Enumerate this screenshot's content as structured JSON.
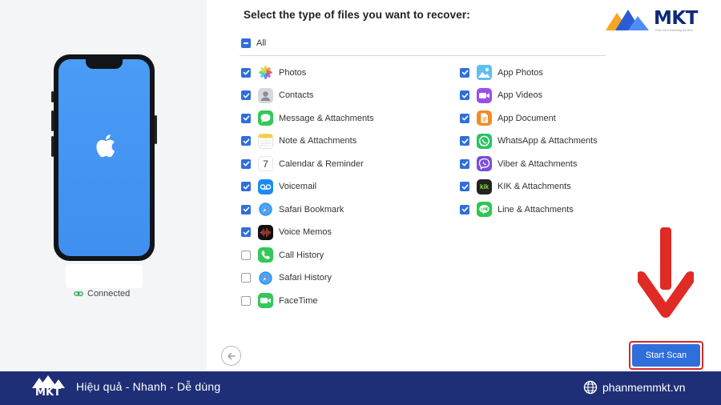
{
  "header": {
    "title": "Select the type of files you want to recover:"
  },
  "select_all": {
    "label": "All",
    "state": "partial"
  },
  "left_column": [
    {
      "label": "Photos",
      "checked": true,
      "icon": "photos-icon"
    },
    {
      "label": "Contacts",
      "checked": true,
      "icon": "contacts-icon"
    },
    {
      "label": "Message & Attachments",
      "checked": true,
      "icon": "messages-icon"
    },
    {
      "label": "Note & Attachments",
      "checked": true,
      "icon": "notes-icon"
    },
    {
      "label": "Calendar & Reminder",
      "checked": true,
      "icon": "calendar-icon",
      "glyph": "7"
    },
    {
      "label": "Voicemail",
      "checked": true,
      "icon": "voicemail-icon"
    },
    {
      "label": "Safari Bookmark",
      "checked": true,
      "icon": "safari-icon"
    },
    {
      "label": "Voice Memos",
      "checked": true,
      "icon": "voice-memos-icon"
    },
    {
      "label": "Call History",
      "checked": false,
      "icon": "phone-icon"
    },
    {
      "label": "Safari History",
      "checked": false,
      "icon": "safari-icon"
    },
    {
      "label": "FaceTime",
      "checked": false,
      "icon": "facetime-icon"
    }
  ],
  "right_column": [
    {
      "label": "App Photos",
      "checked": true,
      "icon": "app-photos-icon"
    },
    {
      "label": "App Videos",
      "checked": true,
      "icon": "app-videos-icon"
    },
    {
      "label": "App Document",
      "checked": true,
      "icon": "app-document-icon"
    },
    {
      "label": "WhatsApp & Attachments",
      "checked": true,
      "icon": "whatsapp-icon"
    },
    {
      "label": "Viber & Attachments",
      "checked": true,
      "icon": "viber-icon"
    },
    {
      "label": "KIK & Attachments",
      "checked": true,
      "icon": "kik-icon",
      "glyph": "kik"
    },
    {
      "label": "Line & Attachments",
      "checked": true,
      "icon": "line-icon"
    }
  ],
  "device": {
    "status": "Connected"
  },
  "actions": {
    "start_scan": "Start Scan"
  },
  "brand": {
    "logo_text": "MKT",
    "logo_sub": "Phần mềm Marketing đa kênh",
    "footer_logo": "MKT",
    "slogan": "Hiệu quả - Nhanh - Dễ dùng",
    "website": "phanmemmkt.vn"
  },
  "colors": {
    "accent": "#2f6fdb",
    "highlight": "#d62828",
    "footer": "#1f2f77",
    "phone_screen": "#4a9cf5"
  }
}
